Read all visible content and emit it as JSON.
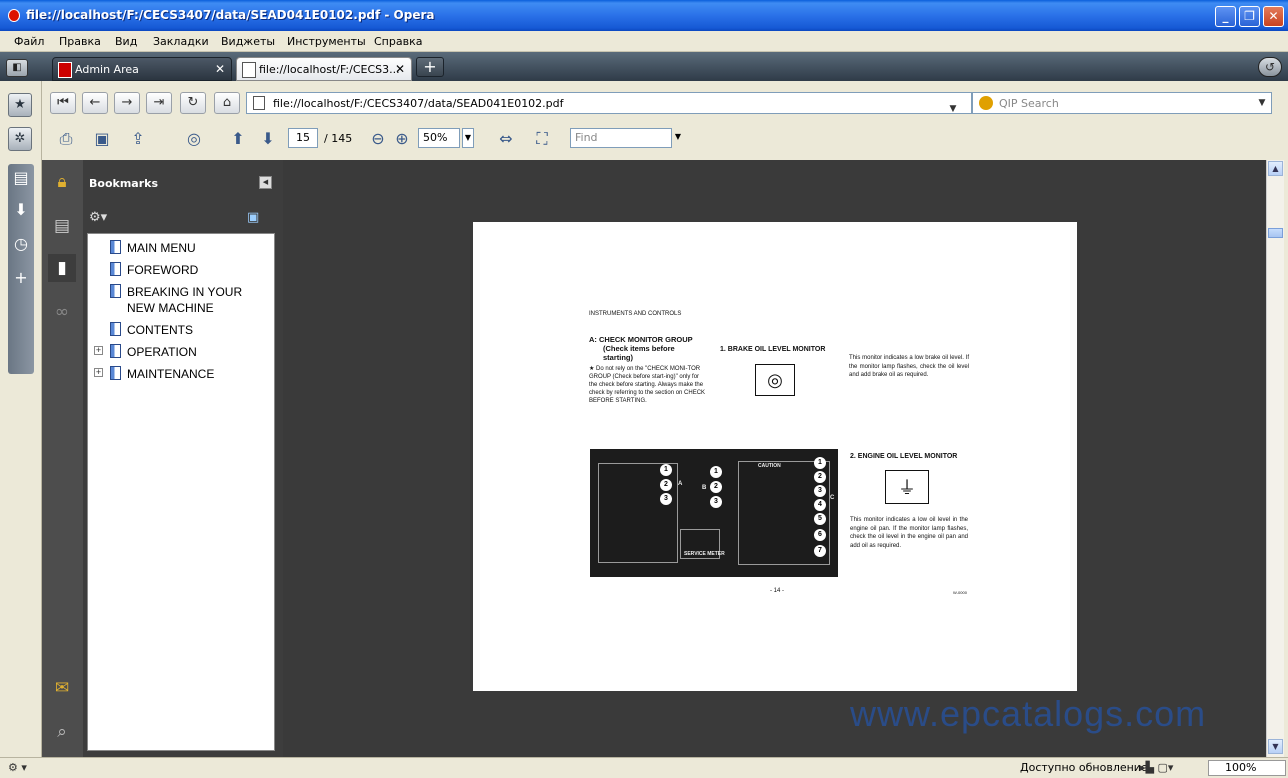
{
  "window": {
    "title": "file://localhost/F:/CECS3407/data/SEAD041E0102.pdf - Opera",
    "minimize": "_",
    "maximize": "❐",
    "close": "✕"
  },
  "menu": [
    "Файл",
    "Правка",
    "Вид",
    "Закладки",
    "Виджеты",
    "Инструменты",
    "Справка"
  ],
  "tabs": [
    {
      "label": "Admin Area",
      "close": "✕"
    },
    {
      "label": "file://localhost/F:/CECS3...",
      "close": "✕"
    }
  ],
  "address": {
    "url": "file://localhost/F:/CECS3407/data/SEAD041E0102.pdf",
    "search_placeholder": "QIP Search"
  },
  "pdf_toolbar": {
    "page_current": "15",
    "page_total": "/ 145",
    "zoom": "50%",
    "find_placeholder": "Find"
  },
  "bookmarks": {
    "title": "Bookmarks",
    "items": [
      {
        "label": "MAIN MENU",
        "expandable": false
      },
      {
        "label": "FOREWORD",
        "expandable": false
      },
      {
        "label": "BREAKING IN YOUR NEW MACHINE",
        "expandable": false
      },
      {
        "label": "CONTENTS",
        "expandable": false
      },
      {
        "label": "OPERATION",
        "expandable": true
      },
      {
        "label": "MAINTENANCE",
        "expandable": true
      }
    ]
  },
  "page": {
    "section": "INSTRUMENTS AND CONTROLS",
    "check_group_line1": "A:  CHECK MONITOR GROUP",
    "check_group_line2": "(Check items before",
    "check_group_line3": "starting)",
    "note": "★ Do not rely on the \"CHECK MONI-TOR GROUP (Check before start-ing)\" only for the check before starting. Always make the check by referring to the section on CHECK BEFORE STARTING.",
    "brake_heading": "1. BRAKE OIL LEVEL MONITOR",
    "brake_body": "This monitor indicates a low brake oil level. If the monitor lamp flashes, check the oil level and add brake oil as required.",
    "engine_heading": "2. ENGINE OIL LEVEL MONITOR",
    "engine_body": "This monitor indicates a low oil level in the engine oil pan. If the monitor lamp flashes, check the oil level in the engine oil pan and add oil as required.",
    "page_number": "- 14 -",
    "code": "W-0000",
    "photo_labels": [
      "A",
      "B",
      "C",
      "CAUTION",
      "SERVICE METER"
    ],
    "photo_numbers_left": [
      "1",
      "2",
      "3"
    ],
    "photo_numbers_mid": [
      "1",
      "2",
      "3"
    ],
    "photo_numbers_right": [
      "1",
      "2",
      "3",
      "4",
      "5",
      "6",
      "7"
    ]
  },
  "watermark": "www.epcatalogs.com",
  "status": {
    "update": "Доступно обновление",
    "zoom": "100%"
  }
}
